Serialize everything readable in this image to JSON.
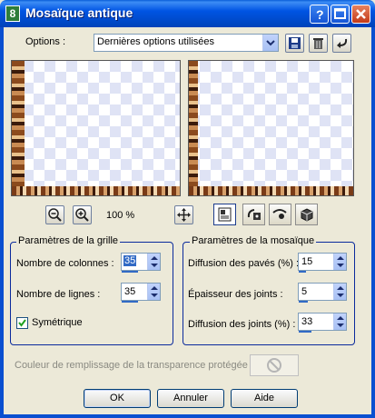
{
  "window": {
    "title": "Mosaïque antique",
    "app_icon_label": "8",
    "title_buttons": [
      "help-icon",
      "maximize-icon",
      "close-icon"
    ]
  },
  "options": {
    "label": "Options :",
    "selected": "Dernières options utilisées",
    "buttons": [
      "save-icon",
      "delete-icon",
      "reset-icon"
    ]
  },
  "zoom": {
    "level": "100 %",
    "buttons": [
      "zoom-out-icon",
      "zoom-in-icon",
      "pan-icon"
    ]
  },
  "tools": [
    "preview-toggle-icon",
    "randomize-icon",
    "proof-icon",
    "cube-icon"
  ],
  "grid_params": {
    "title": "Paramètres de la grille",
    "columns_label": "Nombre de colonnes :",
    "columns_value": "35",
    "rows_label": "Nombre de lignes :",
    "rows_value": "35",
    "symmetric_label": "Symétrique",
    "symmetric_checked": true
  },
  "mosaic_params": {
    "title": "Paramètres de la mosaïque",
    "tile_diffusion_label": "Diffusion des pavés (%) :",
    "tile_diffusion_value": "15",
    "joint_thickness_label": "Épaisseur des joints :",
    "joint_thickness_value": "5",
    "joint_diffusion_label": "Diffusion des joints (%) :",
    "joint_diffusion_value": "33"
  },
  "transparency": {
    "label": "Couleur de remplissage de la transparence protégée :"
  },
  "actions": {
    "ok": "OK",
    "cancel": "Annuler",
    "help": "Aide"
  }
}
